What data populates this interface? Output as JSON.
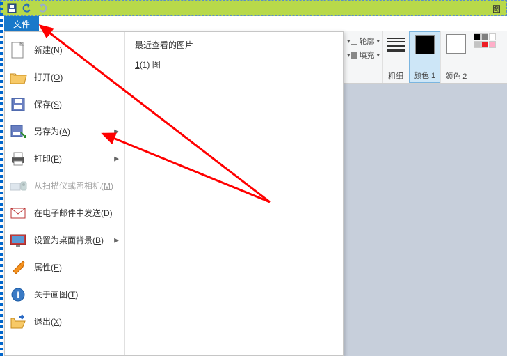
{
  "qat": {
    "title_fragment": "图"
  },
  "file_tab": "文件",
  "menu": [
    {
      "label": "新建(N)",
      "icon": "new",
      "arrow": false,
      "disabled": false
    },
    {
      "label": "打开(O)",
      "icon": "open",
      "arrow": false,
      "disabled": false
    },
    {
      "label": "保存(S)",
      "icon": "save",
      "arrow": false,
      "disabled": false
    },
    {
      "label": "另存为(A)",
      "icon": "saveas",
      "arrow": true,
      "disabled": false
    },
    {
      "label": "打印(P)",
      "icon": "print",
      "arrow": true,
      "disabled": false
    },
    {
      "label": "从扫描仪或照相机(M)",
      "icon": "scanner",
      "arrow": false,
      "disabled": true
    },
    {
      "label": "在电子邮件中发送(D)",
      "icon": "email",
      "arrow": false,
      "disabled": false
    },
    {
      "label": "设置为桌面背景(B)",
      "icon": "desktop",
      "arrow": true,
      "disabled": false
    },
    {
      "label": "属性(E)",
      "icon": "properties",
      "arrow": false,
      "disabled": false
    },
    {
      "label": "关于画图(T)",
      "icon": "about",
      "arrow": false,
      "disabled": false
    },
    {
      "label": "退出(X)",
      "icon": "exit",
      "arrow": false,
      "disabled": false
    }
  ],
  "recent": {
    "title": "最近查看的图片",
    "items": [
      "1(1)  图"
    ]
  },
  "ribbon": {
    "outline": "轮廓",
    "fill": "填充",
    "thickness": "粗细",
    "color1": "颜色 1",
    "color2": "颜色 2",
    "color1_hex": "#000000",
    "color2_hex": "#ffffff",
    "palette": [
      "#000000",
      "#7f7f7f",
      "#ffffff",
      "#c3c3c3",
      "#ed1c24",
      "#ffaec9"
    ]
  }
}
